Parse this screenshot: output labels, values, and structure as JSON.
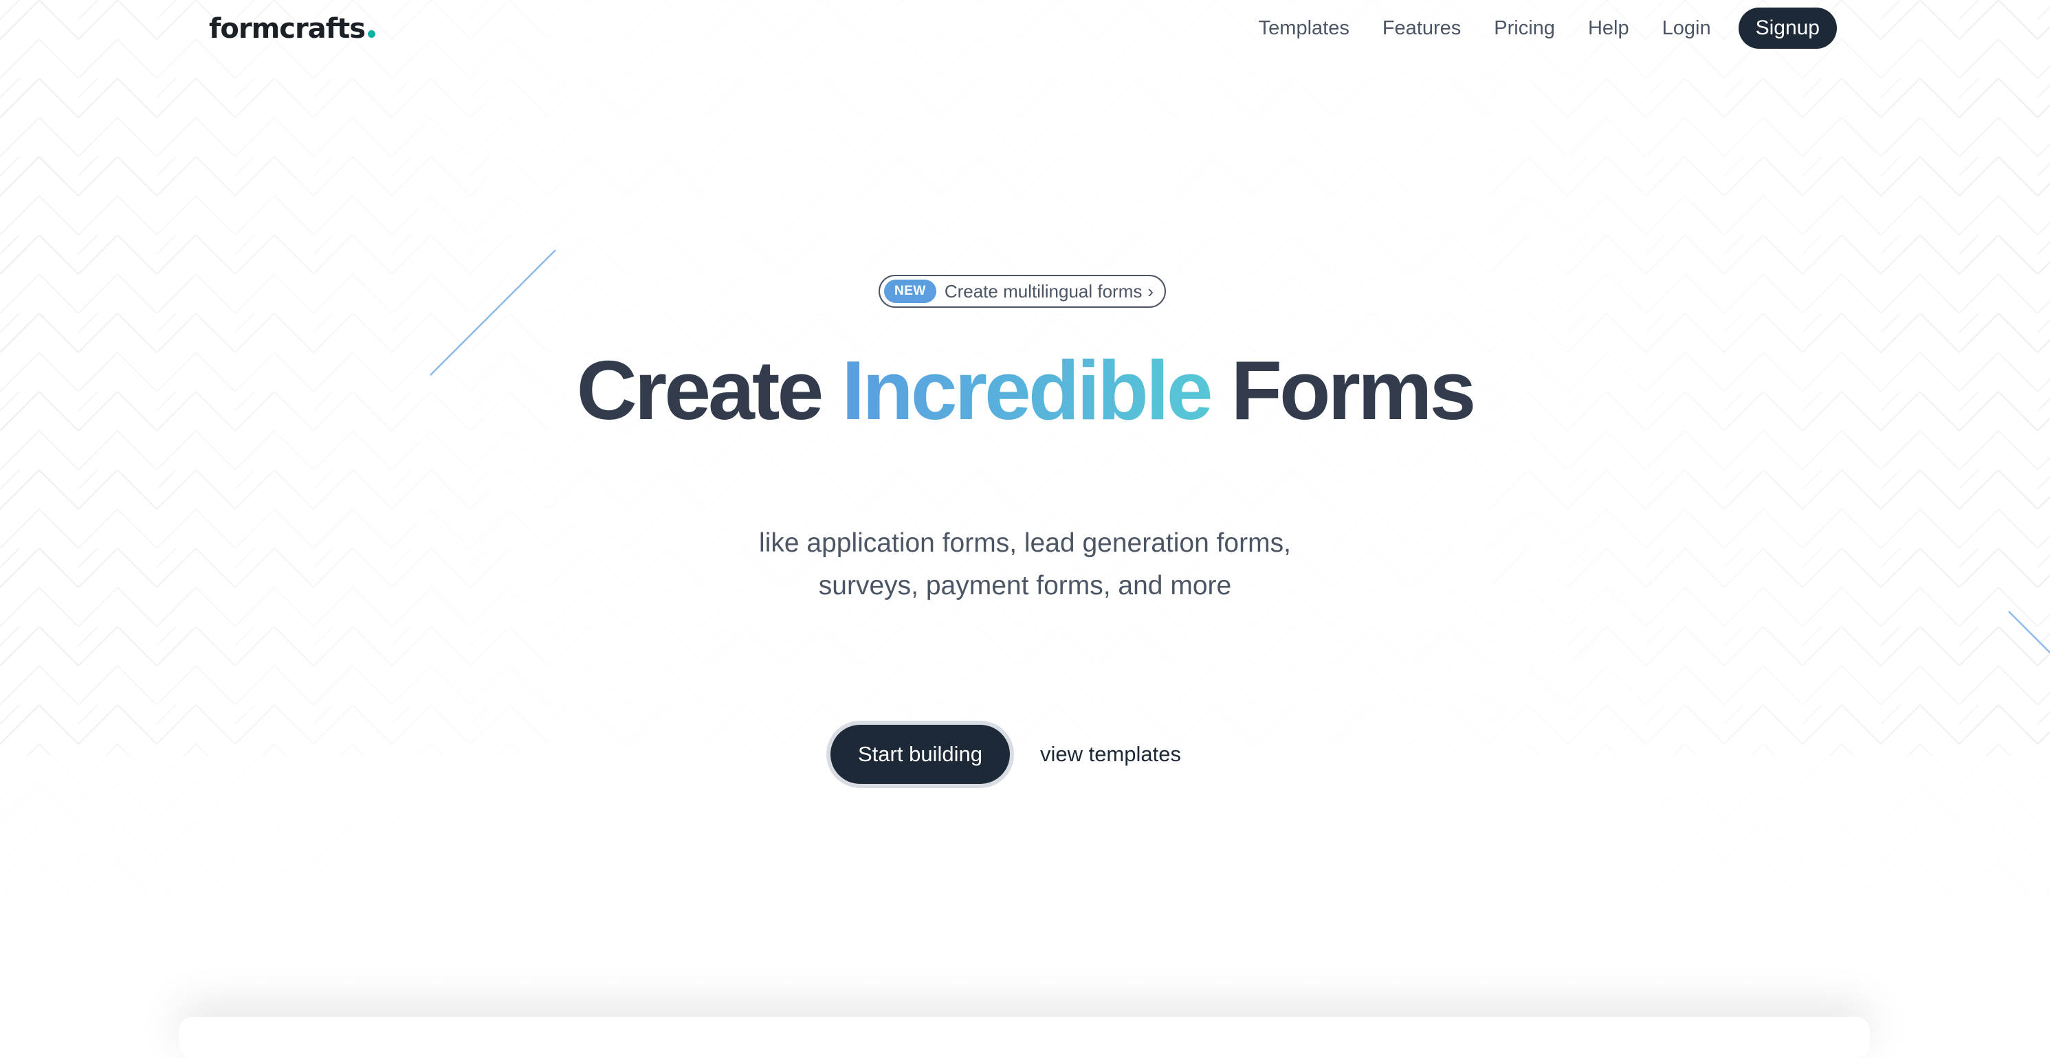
{
  "brand": {
    "name": "formcrafts",
    "dot_color": "#10b3a3"
  },
  "nav": {
    "items": [
      "Templates",
      "Features",
      "Pricing",
      "Help",
      "Login"
    ],
    "signup_label": "Signup"
  },
  "hero": {
    "badge_label": "NEW",
    "badge_text": "Create multilingual forms",
    "badge_chevron": "›",
    "headline_before": "Create",
    "headline_highlight": "Incredible",
    "headline_after": "Forms",
    "subline_1": "like application forms, lead generation forms,",
    "subline_2": "surveys, payment forms, and more",
    "primary_cta": "Start building",
    "secondary_cta": "view templates"
  },
  "colors": {
    "dark": "#1e2938",
    "headline": "#323c4c",
    "accent_blue": "#5a9ee0",
    "accent_teal": "#56c7d6",
    "badge_blue": "#5a9ee0",
    "pattern_line": "#e9edf1"
  }
}
